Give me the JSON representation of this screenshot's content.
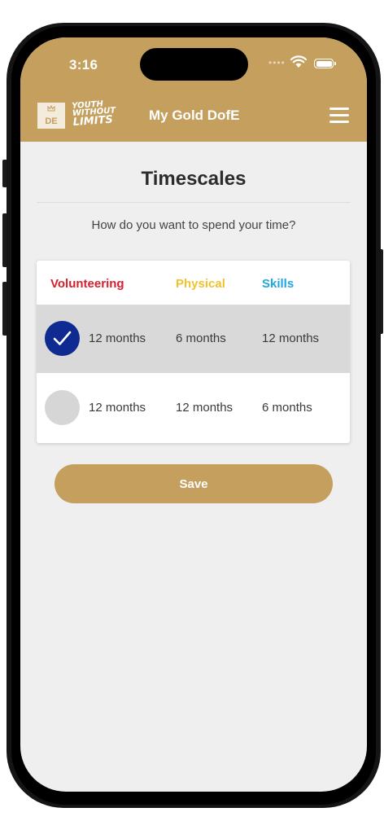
{
  "status_bar": {
    "time": "3:16",
    "signal_icon": "signal-dots-icon",
    "wifi_icon": "wifi-icon",
    "battery_icon": "battery-icon"
  },
  "header": {
    "logo_text": "DE",
    "brand_lines": [
      "YOUTH",
      "WITHOUT",
      "LIMITS"
    ],
    "title": "My Gold DofE",
    "menu_icon": "hamburger-menu-icon"
  },
  "page": {
    "title": "Timescales",
    "subtitle": "How do you want to spend your time?"
  },
  "table": {
    "columns": [
      {
        "label": "Volunteering",
        "color": "#d51f2e"
      },
      {
        "label": "Physical",
        "color": "#f2c22c"
      },
      {
        "label": "Skills",
        "color": "#1fa7e0"
      }
    ],
    "options": [
      {
        "selected": true,
        "values": [
          "12 months",
          "6 months",
          "12 months"
        ]
      },
      {
        "selected": false,
        "values": [
          "12 months",
          "12 months",
          "6 months"
        ]
      }
    ]
  },
  "save_label": "Save",
  "colors": {
    "brand_gold": "#c49f5d",
    "selected_radio": "#0f2b91"
  }
}
